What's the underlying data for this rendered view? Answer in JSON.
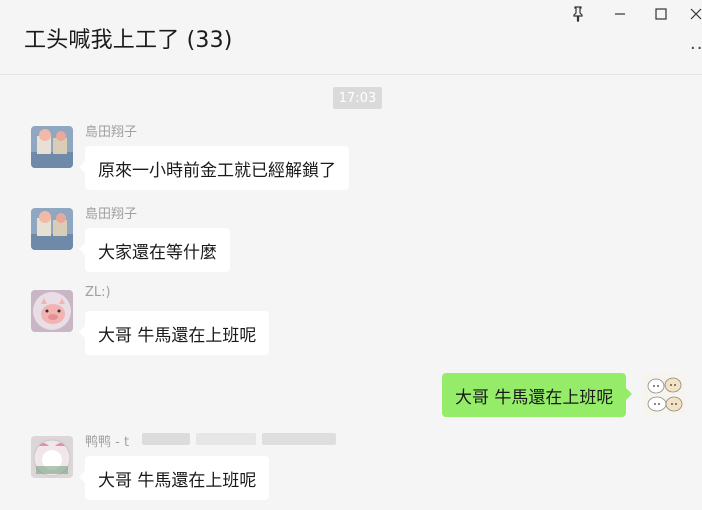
{
  "window": {
    "title": "工头喊我上工了 (33)",
    "controls": [
      "pin-icon",
      "minimize-icon",
      "maximize-icon",
      "close-icon"
    ],
    "more_label": "..."
  },
  "timestamp": "17:03",
  "messages": [
    {
      "sender": "島田翔子",
      "text": "原來一小時前金工就已經解鎖了",
      "mine": false
    },
    {
      "sender": "島田翔子",
      "text": "大家還在等什麼",
      "mine": false
    },
    {
      "sender": "ZL:)",
      "text": "大哥 牛馬還在上班呢",
      "mine": false
    },
    {
      "sender": "",
      "text": "大哥 牛馬還在上班呢",
      "mine": true
    },
    {
      "sender": "鸭鸭 - t",
      "text": "大哥 牛馬還在上班呢",
      "mine": false
    }
  ],
  "colors": {
    "background": "#f5f5f5",
    "bubble_incoming": "#ffffff",
    "bubble_outgoing": "#95ec69",
    "sender_text": "#a0a0a0"
  }
}
